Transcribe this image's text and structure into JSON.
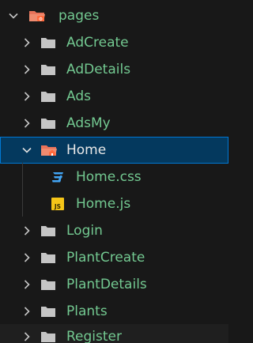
{
  "explorer": {
    "root": {
      "label": "pages",
      "icon": "folder-src-open-icon"
    },
    "items": [
      {
        "label": "AdCreate",
        "icon": "folder-icon"
      },
      {
        "label": "AdDetails",
        "icon": "folder-icon"
      },
      {
        "label": "Ads",
        "icon": "folder-icon"
      },
      {
        "label": "AdsMy",
        "icon": "folder-icon"
      },
      {
        "label": "Home",
        "icon": "folder-home-open-icon"
      },
      {
        "label": "Home.css",
        "icon": "css-file-icon"
      },
      {
        "label": "Home.js",
        "icon": "js-file-icon",
        "icon_text": "JS"
      },
      {
        "label": "Login",
        "icon": "folder-icon"
      },
      {
        "label": "PlantCreate",
        "icon": "folder-icon"
      },
      {
        "label": "PlantDetails",
        "icon": "folder-icon"
      },
      {
        "label": "Plants",
        "icon": "folder-icon"
      },
      {
        "label": "Register",
        "icon": "folder-icon"
      }
    ]
  },
  "colors": {
    "background": "#181818",
    "modified_text": "#73c991",
    "selected_background": "#04395e",
    "focus_border": "#0078d4",
    "folder": "#c5c5c5",
    "css_icon": "#42a5f5",
    "js_icon": "#f5c518"
  }
}
